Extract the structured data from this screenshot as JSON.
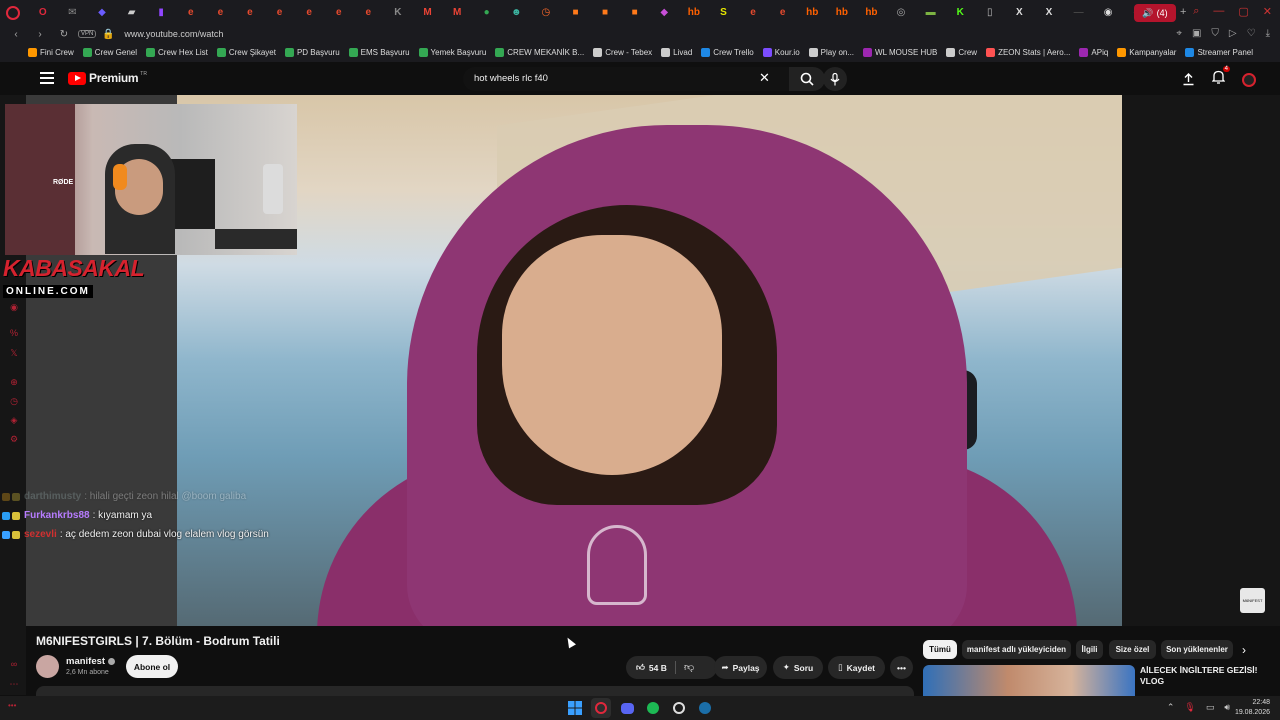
{
  "browser": {
    "url": "www.youtube.com/watch",
    "vpn_label": "VPN",
    "active_tab_badge": "(4)",
    "tab_icons": [
      {
        "icon": "opera-icon",
        "color": "#e0283c",
        "glyph": "O"
      },
      {
        "icon": "mail-icon",
        "color": "#888888",
        "glyph": "✉"
      },
      {
        "icon": "shield-icon",
        "color": "#6a5cff",
        "glyph": "◆"
      },
      {
        "icon": "dev-icon",
        "color": "#cccccc",
        "glyph": "▰"
      },
      {
        "icon": "twitch-icon",
        "color": "#9146ff",
        "glyph": "▮"
      },
      {
        "icon": "e-icon",
        "color": "#e64a2e",
        "glyph": "e"
      },
      {
        "icon": "e-icon",
        "color": "#e64a2e",
        "glyph": "e"
      },
      {
        "icon": "e-icon",
        "color": "#e64a2e",
        "glyph": "e"
      },
      {
        "icon": "e-icon",
        "color": "#e64a2e",
        "glyph": "e"
      },
      {
        "icon": "e-icon",
        "color": "#e64a2e",
        "glyph": "e"
      },
      {
        "icon": "e-icon",
        "color": "#e64a2e",
        "glyph": "e"
      },
      {
        "icon": "e-icon",
        "color": "#e64a2e",
        "glyph": "e"
      },
      {
        "icon": "k-icon",
        "color": "#888888",
        "glyph": "K"
      },
      {
        "icon": "gmail-icon",
        "color": "#ea4335",
        "glyph": "M"
      },
      {
        "icon": "gmail-icon",
        "color": "#ea4335",
        "glyph": "M"
      },
      {
        "icon": "green-icon",
        "color": "#34a853",
        "glyph": "●"
      },
      {
        "icon": "game-icon",
        "color": "#3cb4a0",
        "glyph": "☻"
      },
      {
        "icon": "clock-icon",
        "color": "#ff6a2a",
        "glyph": "◷"
      },
      {
        "icon": "orange-icon",
        "color": "#ff7a1a",
        "glyph": "■"
      },
      {
        "icon": "orange-icon",
        "color": "#ff7a1a",
        "glyph": "■"
      },
      {
        "icon": "orange-icon",
        "color": "#ff7a1a",
        "glyph": "■"
      },
      {
        "icon": "pink-icon",
        "color": "#c84fd8",
        "glyph": "◆"
      },
      {
        "icon": "hb-icon",
        "color": "#ff6000",
        "glyph": "hb"
      },
      {
        "icon": "s-icon",
        "color": "#e6e600",
        "glyph": "S"
      },
      {
        "icon": "e-icon",
        "color": "#e64a2e",
        "glyph": "e"
      },
      {
        "icon": "e-icon",
        "color": "#e64a2e",
        "glyph": "e"
      },
      {
        "icon": "hb-icon",
        "color": "#ff6000",
        "glyph": "hb"
      },
      {
        "icon": "hb-icon",
        "color": "#ff6000",
        "glyph": "hb"
      },
      {
        "icon": "hb-icon",
        "color": "#ff6000",
        "glyph": "hb"
      },
      {
        "icon": "globe-icon",
        "color": "#aaaaaa",
        "glyph": "◎"
      },
      {
        "icon": "bar-icon",
        "color": "#7cb342",
        "glyph": "▬"
      },
      {
        "icon": "kick-icon",
        "color": "#53fc18",
        "glyph": "K"
      },
      {
        "icon": "doc-icon",
        "color": "#bbbbbb",
        "glyph": "▯"
      },
      {
        "icon": "x-icon",
        "color": "#dddddd",
        "glyph": "X"
      },
      {
        "icon": "x-icon",
        "color": "#dddddd",
        "glyph": "X"
      },
      {
        "icon": "dash-icon",
        "color": "#444444",
        "glyph": "—"
      },
      {
        "icon": "chrome-icon",
        "color": "#dddddd",
        "glyph": "◉"
      },
      {
        "icon": "chrome-icon",
        "color": "#dddddd",
        "glyph": "◉"
      }
    ],
    "bookmarks": [
      {
        "label": "Fini Crew",
        "color": "#ff9800"
      },
      {
        "label": "Crew Genel",
        "color": "#34a853"
      },
      {
        "label": "Crew Hex List",
        "color": "#34a853"
      },
      {
        "label": "Crew Şikayet",
        "color": "#34a853"
      },
      {
        "label": "PD Başvuru",
        "color": "#34a853"
      },
      {
        "label": "EMS Başvuru",
        "color": "#34a853"
      },
      {
        "label": "Yemek Başvuru",
        "color": "#34a853"
      },
      {
        "label": "CREW MEKANİK B...",
        "color": "#34a853"
      },
      {
        "label": "Crew - Tebex",
        "color": "#cccccc"
      },
      {
        "label": "Livad",
        "color": "#cccccc"
      },
      {
        "label": "Crew Trello",
        "color": "#1e88e5"
      },
      {
        "label": "Kour.io",
        "color": "#7c4dff"
      },
      {
        "label": "Play on...",
        "color": "#cccccc"
      },
      {
        "label": "WL MOUSE HUB",
        "color": "#9c27b0"
      },
      {
        "label": "Crew",
        "color": "#cccccc"
      },
      {
        "label": "ZEON Stats | Aero...",
        "color": "#ff5252"
      },
      {
        "label": "APiq",
        "color": "#9c27b0"
      },
      {
        "label": "Kampanyalar",
        "color": "#ff9800"
      },
      {
        "label": "Streamer Panel",
        "color": "#1e88e5"
      }
    ]
  },
  "youtube": {
    "logo_text": "Premium",
    "logo_region": "TR",
    "search_query": "hot wheels rlc f40",
    "notifications_count": "4",
    "video": {
      "title": "M6NIFESTGIRLS | 7. Bölüm - Bodrum Tatili",
      "watermark": "M6NIFEST"
    },
    "channel": {
      "name": "manifest",
      "subscribers": "2,6 Mn abone",
      "subscribe_label": "Abone ol"
    },
    "actions": {
      "likes": "54 B",
      "share": "Paylaş",
      "ask": "Soru",
      "save": "Kaydet"
    },
    "chips": [
      "Tümü",
      "manifest adlı yükleyiciden",
      "İlgili",
      "Size özel",
      "Son yüklenenler"
    ],
    "recommendation": {
      "title": "AİLECEK İNGİLTERE GEZİSİ! VLOG"
    }
  },
  "stream_overlay": {
    "logo_top": "KABASAKAL",
    "logo_bottom": "ONLINE.COM",
    "mic_brand": "RØDE",
    "chat": [
      {
        "user": "darthimusty",
        "message": ": hilali geçti zeon hilal @boom galiba",
        "color": "#8fa3a3",
        "faded": true
      },
      {
        "user": "Furkankrbs88",
        "message": ": kıyamam ya",
        "color": "#b77cff",
        "faded": false
      },
      {
        "user": "sezevli",
        "message": ": aç dedem zeon dubai vlog elalem vlog görsün",
        "color": "#d13030",
        "faded": false
      }
    ]
  },
  "taskbar": {
    "time": "22:48",
    "date": "19.08.2026"
  }
}
